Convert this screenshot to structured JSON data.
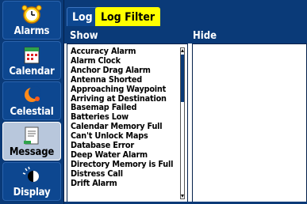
{
  "sidebar": {
    "items": [
      {
        "label": "Alarms",
        "icon": "alarm-clock-icon"
      },
      {
        "label": "Calendar",
        "icon": "calendar-icon"
      },
      {
        "label": "Celestial",
        "icon": "celestial-icon"
      },
      {
        "label": "Message",
        "icon": "message-log-icon",
        "selected": true
      },
      {
        "label": "Display",
        "icon": "display-icon"
      }
    ]
  },
  "tabs": [
    {
      "label": "Log"
    },
    {
      "label": "Log Filter",
      "active": true
    }
  ],
  "columns": {
    "show": "Show",
    "hide": "Hide"
  },
  "show_list": [
    "Accuracy Alarm",
    "Alarm Clock",
    "Anchor Drag Alarm",
    "Antenna Shorted",
    "Approaching Waypoint",
    "Arriving at Destination",
    "Basemap Failed",
    "Batteries Low",
    "Calendar Memory Full",
    "Can't Unlock Maps",
    "Database Error",
    "Deep Water Alarm",
    "Directory Memory is Full",
    "Distress Call",
    "Drift Alarm"
  ],
  "hide_list": [],
  "colors": {
    "sidebar_bg": "#0a3a78",
    "active_tab": "#ffff00",
    "selected_item": "#b8c7dc"
  }
}
